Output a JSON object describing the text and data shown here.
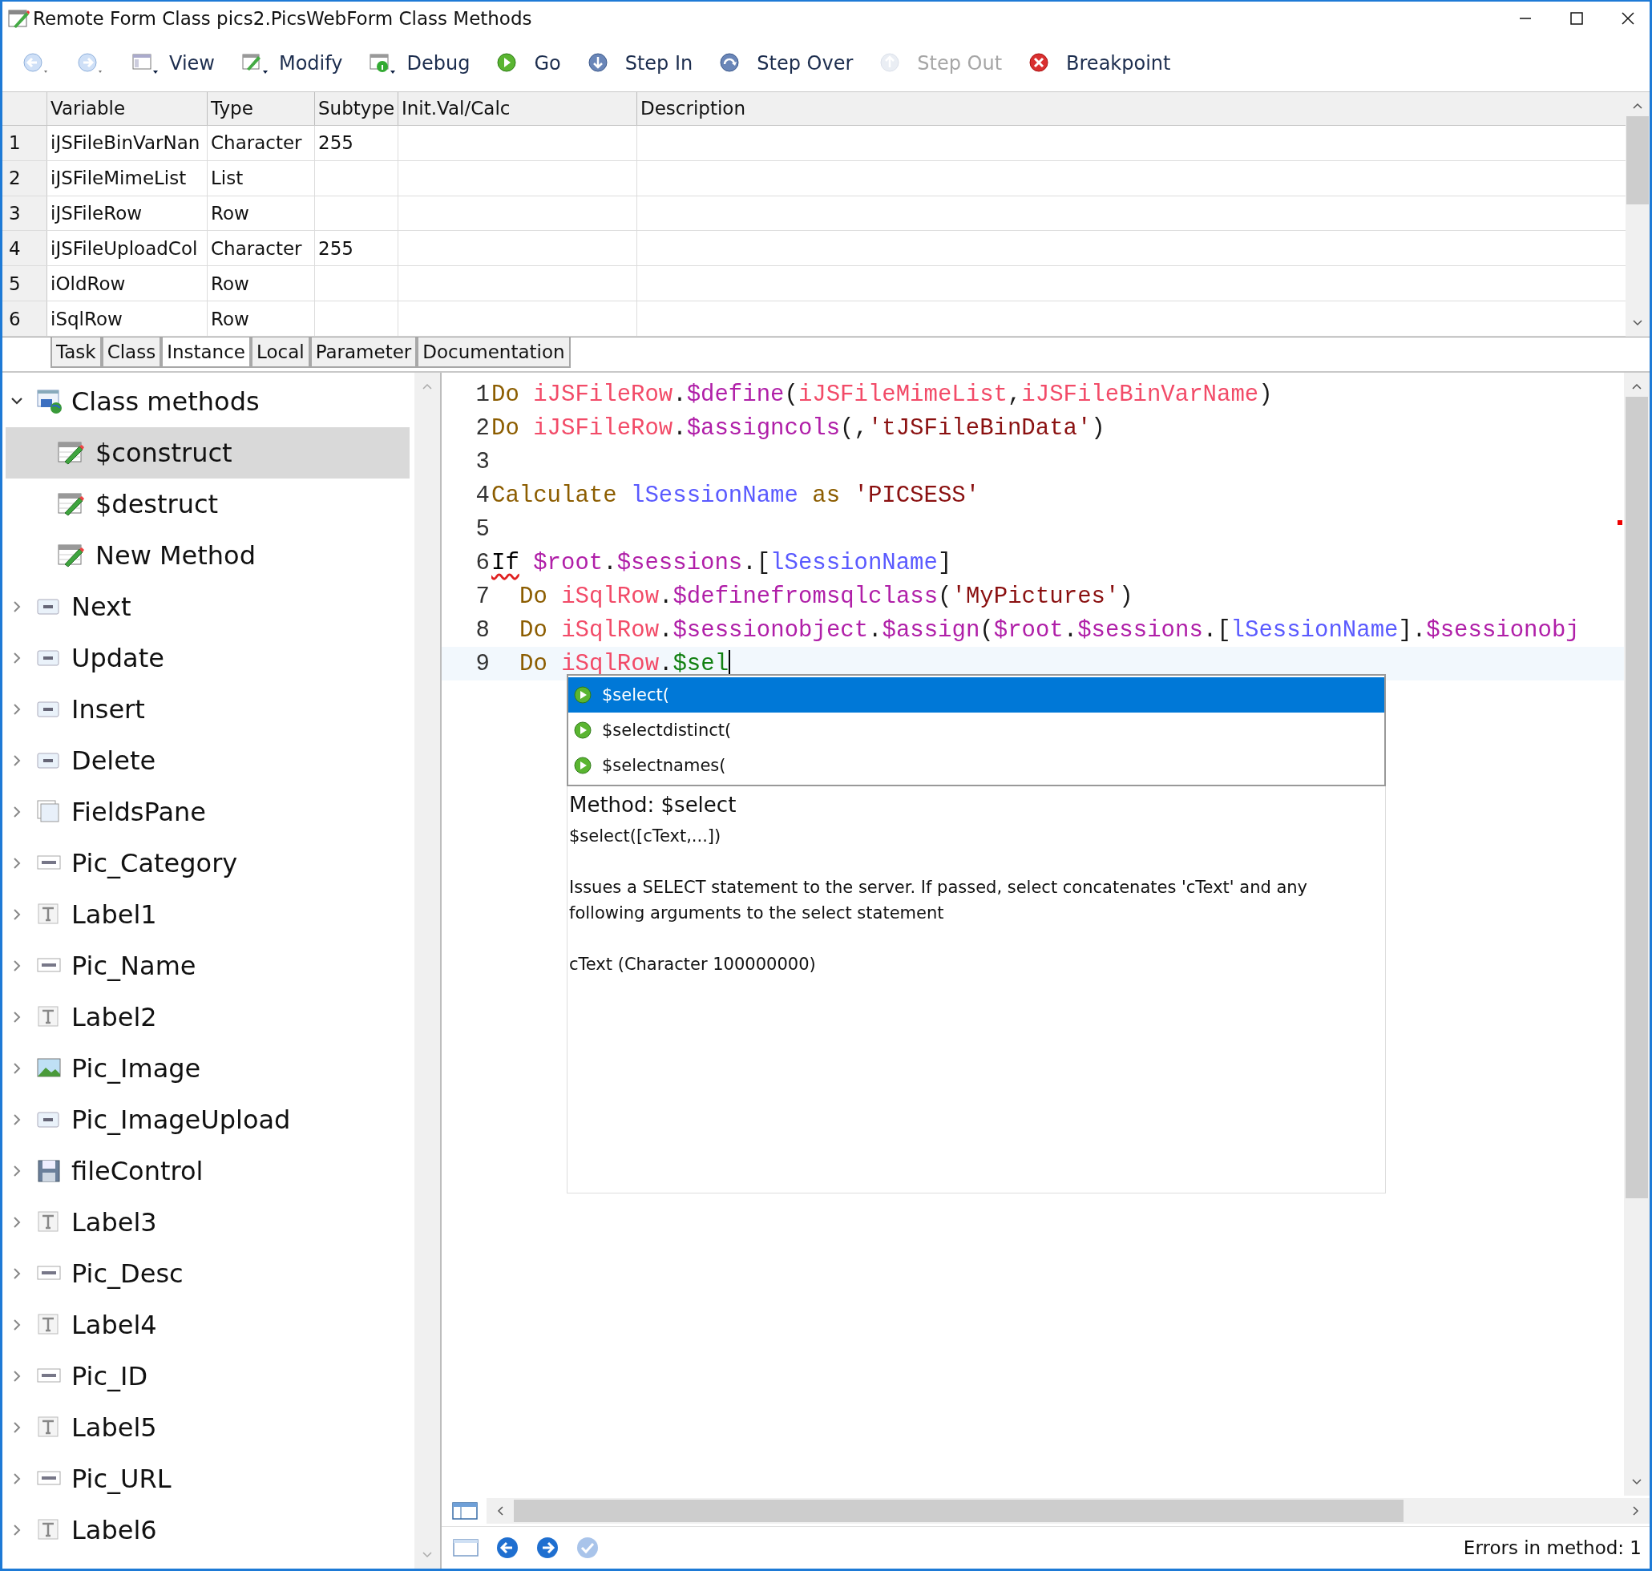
{
  "window": {
    "title": "Remote Form Class pics2.PicsWebForm Class Methods"
  },
  "toolbar": [
    {
      "kind": "back",
      "disabled": false
    },
    {
      "kind": "forward",
      "disabled": false
    },
    {
      "kind": "view",
      "label": "View",
      "disabled": false
    },
    {
      "kind": "modify",
      "label": "Modify",
      "disabled": false
    },
    {
      "kind": "debug",
      "label": "Debug",
      "disabled": false
    },
    {
      "kind": "go",
      "label": "Go",
      "disabled": false
    },
    {
      "kind": "step_in",
      "label": "Step In",
      "disabled": false
    },
    {
      "kind": "step_over",
      "label": "Step Over",
      "disabled": false
    },
    {
      "kind": "step_out",
      "label": "Step Out",
      "disabled": true
    },
    {
      "kind": "breakpoint",
      "label": "Breakpoint",
      "disabled": false
    }
  ],
  "variables": {
    "columns": [
      "Variable",
      "Type",
      "Subtype",
      "Init.Val/Calc",
      "Description"
    ],
    "rows": [
      {
        "number": "1",
        "variable": "iJSFileBinVarNan",
        "type": "Character",
        "subtype": "255"
      },
      {
        "number": "2",
        "variable": "iJSFileMimeList",
        "type": "List"
      },
      {
        "number": "3",
        "variable": "iJSFileRow",
        "type": "Row"
      },
      {
        "number": "4",
        "variable": "iJSFileUploadCol",
        "type": "Character",
        "subtype": "255"
      },
      {
        "number": "5",
        "variable": "iOldRow",
        "type": "Row"
      },
      {
        "number": "6",
        "variable": "iSqlRow",
        "type": "Row"
      }
    ]
  },
  "variable_tabs": [
    {
      "label": "Task",
      "selected": false
    },
    {
      "label": "Class",
      "selected": false
    },
    {
      "label": "Instance",
      "selected": true
    },
    {
      "label": "Local",
      "selected": false
    },
    {
      "label": "Parameter",
      "selected": false
    },
    {
      "label": "Documentation",
      "selected": false
    }
  ],
  "tree": [
    {
      "label": "Class methods",
      "kind": "class",
      "expanded": true,
      "selected": false,
      "children": [
        {
          "label": "$construct",
          "kind": "method",
          "selected": true
        },
        {
          "label": "$destruct",
          "kind": "method",
          "selected": false
        },
        {
          "label": "New Method",
          "kind": "method",
          "selected": false
        }
      ]
    },
    {
      "label": "Next",
      "kind": "button",
      "expanded": false,
      "selected": false
    },
    {
      "label": "Update",
      "kind": "button",
      "expanded": false,
      "selected": false
    },
    {
      "label": "Insert",
      "kind": "button",
      "expanded": false,
      "selected": false
    },
    {
      "label": "Delete",
      "kind": "button",
      "expanded": false,
      "selected": false
    },
    {
      "label": "FieldsPane",
      "kind": "pane",
      "expanded": false,
      "selected": false
    },
    {
      "label": "Pic_Category",
      "kind": "field",
      "expanded": false,
      "selected": false
    },
    {
      "label": "Label1",
      "kind": "label",
      "expanded": false,
      "selected": false
    },
    {
      "label": "Pic_Name",
      "kind": "field",
      "expanded": false,
      "selected": false
    },
    {
      "label": "Label2",
      "kind": "label",
      "expanded": false,
      "selected": false
    },
    {
      "label": "Pic_Image",
      "kind": "picture",
      "expanded": false,
      "selected": false
    },
    {
      "label": "Pic_ImageUpload",
      "kind": "button",
      "expanded": false,
      "selected": false
    },
    {
      "label": "fileControl",
      "kind": "file",
      "expanded": false,
      "selected": false
    },
    {
      "label": "Label3",
      "kind": "label",
      "expanded": false,
      "selected": false
    },
    {
      "label": "Pic_Desc",
      "kind": "field",
      "expanded": false,
      "selected": false
    },
    {
      "label": "Label4",
      "kind": "label",
      "expanded": false,
      "selected": false
    },
    {
      "label": "Pic_ID",
      "kind": "field",
      "expanded": false,
      "selected": false
    },
    {
      "label": "Label5",
      "kind": "label",
      "expanded": false,
      "selected": false
    },
    {
      "label": "Pic_URL",
      "kind": "field",
      "expanded": false,
      "selected": false
    },
    {
      "label": "Label6",
      "kind": "label",
      "expanded": false,
      "selected": false
    }
  ],
  "editor": {
    "lines": [
      {
        "number": "1",
        "indent": false,
        "current": false,
        "tokens": [
          {
            "kind": "keyword",
            "text": "Do "
          },
          {
            "kind": "variable",
            "text": "iJSFileRow"
          },
          {
            "kind": "punct",
            "text": "."
          },
          {
            "kind": "method",
            "text": "$define"
          },
          {
            "kind": "punct",
            "text": "("
          },
          {
            "kind": "variable",
            "text": "iJSFileMimeList"
          },
          {
            "kind": "punct",
            "text": ","
          },
          {
            "kind": "variable",
            "text": "iJSFileBinVarName"
          },
          {
            "kind": "punct",
            "text": ")"
          }
        ]
      },
      {
        "number": "2",
        "indent": false,
        "current": false,
        "tokens": [
          {
            "kind": "keyword",
            "text": "Do "
          },
          {
            "kind": "variable",
            "text": "iJSFileRow"
          },
          {
            "kind": "punct",
            "text": "."
          },
          {
            "kind": "method",
            "text": "$assigncols"
          },
          {
            "kind": "punct",
            "text": "(,"
          },
          {
            "kind": "string",
            "text": "'tJSFileBinData'"
          },
          {
            "kind": "punct",
            "text": ")"
          }
        ]
      },
      {
        "number": "3",
        "current": false
      },
      {
        "number": "4",
        "indent": false,
        "current": false,
        "tokens": [
          {
            "kind": "keyword",
            "text": "Calculate "
          },
          {
            "kind": "local",
            "text": "lSessionName"
          },
          {
            "kind": "keyword",
            "text": " as "
          },
          {
            "kind": "string",
            "text": "'PICSESS'"
          }
        ]
      },
      {
        "number": "5",
        "current": false
      },
      {
        "number": "6",
        "indent": false,
        "current": false,
        "tokens": [
          {
            "kind": "control",
            "text": "If",
            "error": true
          },
          {
            "kind": "method",
            "text": " $root"
          },
          {
            "kind": "punct",
            "text": "."
          },
          {
            "kind": "method",
            "text": "$sessions"
          },
          {
            "kind": "punct",
            "text": ".["
          },
          {
            "kind": "local",
            "text": "lSessionName"
          },
          {
            "kind": "punct",
            "text": "]"
          }
        ]
      },
      {
        "number": "7",
        "indent": true,
        "current": false,
        "tokens": [
          {
            "kind": "keyword",
            "text": "Do "
          },
          {
            "kind": "variable",
            "text": "iSqlRow"
          },
          {
            "kind": "punct",
            "text": "."
          },
          {
            "kind": "method",
            "text": "$definefromsqlclass"
          },
          {
            "kind": "punct",
            "text": "("
          },
          {
            "kind": "string",
            "text": "'MyPictures'"
          },
          {
            "kind": "punct",
            "text": ")"
          }
        ]
      },
      {
        "number": "8",
        "indent": true,
        "current": false,
        "tokens": [
          {
            "kind": "keyword",
            "text": "Do "
          },
          {
            "kind": "variable",
            "text": "iSqlRow"
          },
          {
            "kind": "punct",
            "text": "."
          },
          {
            "kind": "method",
            "text": "$sessionobject"
          },
          {
            "kind": "punct",
            "text": "."
          },
          {
            "kind": "method",
            "text": "$assign"
          },
          {
            "kind": "punct",
            "text": "("
          },
          {
            "kind": "method",
            "text": "$root"
          },
          {
            "kind": "punct",
            "text": "."
          },
          {
            "kind": "method",
            "text": "$sessions"
          },
          {
            "kind": "punct",
            "text": ".["
          },
          {
            "kind": "local",
            "text": "lSessionName"
          },
          {
            "kind": "punct",
            "text": "]."
          },
          {
            "kind": "method",
            "text": "$sessionobj"
          }
        ]
      },
      {
        "number": "9",
        "indent": true,
        "current": true,
        "tokens": [
          {
            "kind": "keyword",
            "text": "Do "
          },
          {
            "kind": "variable",
            "text": "iSqlRow"
          },
          {
            "kind": "punct",
            "text": "."
          },
          {
            "kind": "typing",
            "text": "$sel"
          }
        ]
      }
    ]
  },
  "autocomplete": {
    "items": [
      {
        "label": "$select(",
        "selected": true
      },
      {
        "label": "$selectdistinct(",
        "selected": false
      },
      {
        "label": "$selectnames(",
        "selected": false
      }
    ],
    "title": "Method: $select",
    "signature": "$select([cText,...])",
    "description": "Issues a SELECT statement to the server. If passed, select concatenates 'cText' and any following arguments to the select statement",
    "parameter": "cText (Character 100000000)"
  },
  "status_bar": {
    "text": "Errors in method: 1"
  }
}
